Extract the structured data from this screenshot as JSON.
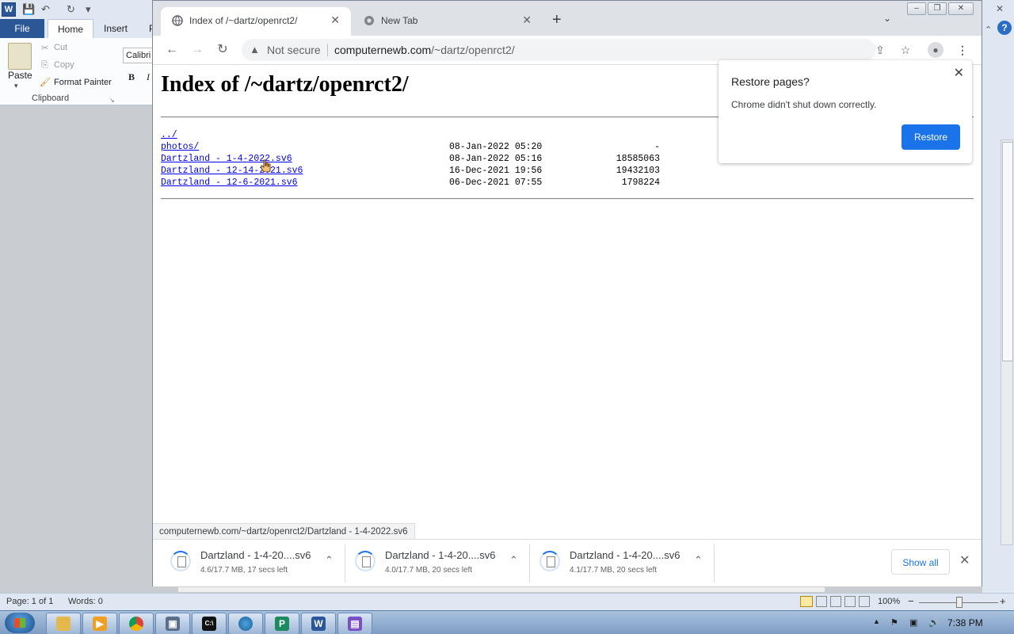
{
  "word": {
    "qat_save": "💾",
    "qat_undo": "↶",
    "qat_redo": "↻",
    "qat_more": "▾",
    "tabs": {
      "file": "File",
      "home": "Home",
      "insert": "Insert",
      "partial": "P"
    },
    "clipboard": {
      "paste": "Paste",
      "cut": "Cut",
      "copy": "Copy",
      "format_painter": "Format Painter",
      "group_label": "Clipboard"
    },
    "font_name": "Calibri",
    "bold": "B",
    "italic": "I",
    "status": {
      "page": "Page: 1 of 1",
      "words": "Words: 0",
      "zoom": "100%",
      "zoom_minus": "−",
      "zoom_plus": "+"
    }
  },
  "chrome": {
    "tabs": [
      {
        "title": "Index of /~dartz/openrct2/"
      },
      {
        "title": "New Tab"
      }
    ],
    "new_tab": "+",
    "omnibox": {
      "security": "Not secure",
      "host": "computernewb.com",
      "path": "/~dartz/openrct2/"
    },
    "page": {
      "heading": "Index of /~dartz/openrct2/",
      "entries": [
        {
          "name": "../",
          "date": "",
          "size": ""
        },
        {
          "name": "photos/",
          "date": "08-Jan-2022 05:20",
          "size": "-"
        },
        {
          "name": "Dartzland - 1-4-2022.sv6",
          "date": "08-Jan-2022 05:16",
          "size": "18585063"
        },
        {
          "name": "Dartzland - 12-14-2021.sv6",
          "date": "16-Dec-2021 19:56",
          "size": "19432103"
        },
        {
          "name": "Dartzland - 12-6-2021.sv6",
          "date": "06-Dec-2021 07:55",
          "size": "1798224"
        }
      ]
    },
    "status_url": "computernewb.com/~dartz/openrct2/Dartzland - 1-4-2022.sv6",
    "restore_popup": {
      "title": "Restore pages?",
      "body": "Chrome didn't shut down correctly.",
      "button": "Restore"
    },
    "downloads": [
      {
        "name": "Dartzland - 1-4-20....sv6",
        "status": "4.6/17.7 MB, 17 secs left"
      },
      {
        "name": "Dartzland - 1-4-20....sv6",
        "status": "4.0/17.7 MB, 20 secs left"
      },
      {
        "name": "Dartzland - 1-4-20....sv6",
        "status": "4.1/17.7 MB, 20 secs left"
      }
    ],
    "show_all": "Show all"
  },
  "taskbar": {
    "clock": "7:38 PM",
    "apps": [
      "explorer-icon",
      "media-player-icon",
      "chrome-icon",
      "virtualbox-icon",
      "cmd-icon",
      "globe-icon",
      "publisher-icon",
      "word-icon",
      "rar-icon"
    ]
  }
}
